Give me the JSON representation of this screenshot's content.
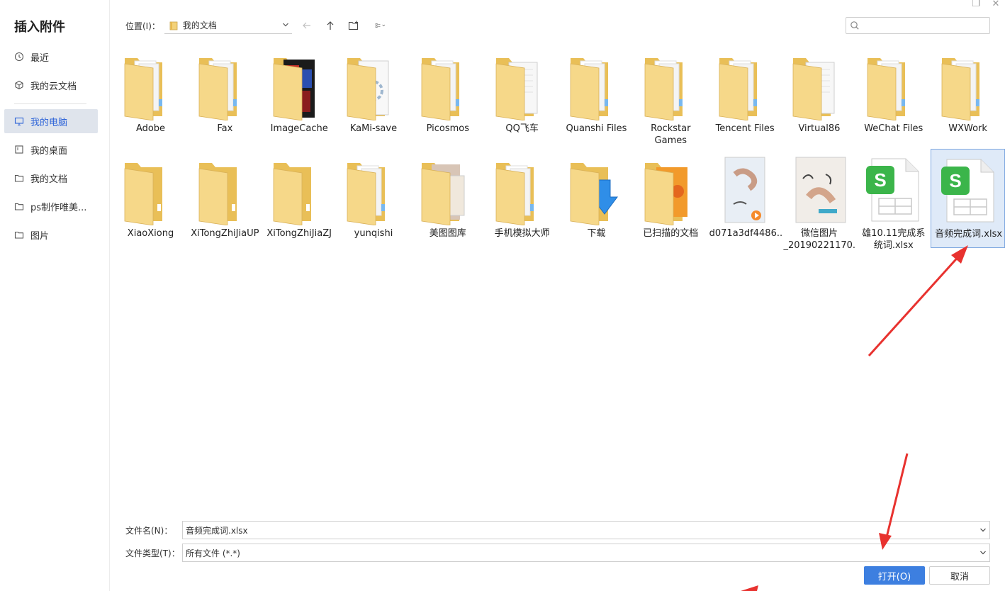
{
  "window": {
    "restore_glyph": "❐",
    "close_glyph": "✕"
  },
  "sidebar": {
    "title": "插入附件",
    "items": [
      {
        "label": "最近",
        "icon": "clock-icon",
        "active": false
      },
      {
        "label": "我的云文档",
        "icon": "cloud-doc-icon",
        "active": false
      },
      {
        "label": "我的电脑",
        "icon": "computer-icon",
        "active": true
      },
      {
        "label": "我的桌面",
        "icon": "desktop-icon",
        "active": false
      },
      {
        "label": "我的文档",
        "icon": "document-folder-icon",
        "active": false
      },
      {
        "label": "ps制作唯美...",
        "icon": "folder-icon",
        "active": false
      },
      {
        "label": "图片",
        "icon": "picture-folder-icon",
        "active": false
      }
    ]
  },
  "toolbar": {
    "location_label": "位置(I)：",
    "location_value": "我的文档",
    "back_icon": "arrow-left-icon",
    "up_icon": "arrow-up-icon",
    "new_folder_icon": "new-folder-icon",
    "view_icon": "list-view-icon"
  },
  "search": {
    "placeholder": "",
    "icon": "search-icon"
  },
  "files": {
    "row1": [
      {
        "name": "Adobe",
        "type": "folder"
      },
      {
        "name": "Fax",
        "type": "folder"
      },
      {
        "name": "ImageCache",
        "type": "folder-image"
      },
      {
        "name": "KaMi-save",
        "type": "folder-gear"
      },
      {
        "name": "Picosmos",
        "type": "folder"
      },
      {
        "name": "QQ飞车",
        "type": "folder-doc"
      },
      {
        "name": "Quanshi Files",
        "type": "folder"
      },
      {
        "name": "Rockstar Games",
        "type": "folder"
      },
      {
        "name": "Tencent Files",
        "type": "folder"
      },
      {
        "name": "Virtual86",
        "type": "folder-doc"
      },
      {
        "name": "WeChat Files",
        "type": "folder"
      },
      {
        "name": "WXWork",
        "type": "folder"
      }
    ],
    "row2": [
      {
        "name": "XiaoXiong",
        "type": "folder-empty"
      },
      {
        "name": "XiTongZhiJiaUP",
        "type": "folder-empty"
      },
      {
        "name": "XiTongZhiJiaZJ",
        "type": "folder-empty"
      },
      {
        "name": "yunqishi",
        "type": "folder"
      },
      {
        "name": "美图图库",
        "type": "folder-photo"
      },
      {
        "name": "手机模拟大师",
        "type": "folder"
      },
      {
        "name": "下载",
        "type": "folder-download"
      },
      {
        "name": "已扫描的文档",
        "type": "folder-flowers"
      },
      {
        "name": "d071a3df4486...",
        "type": "video"
      },
      {
        "name": "微信图片_20190221170...",
        "type": "image"
      },
      {
        "name": "雄10.11完成系统词.xlsx",
        "type": "xlsx"
      },
      {
        "name": "音频完成词.xlsx",
        "type": "xlsx",
        "selected": true
      }
    ]
  },
  "form": {
    "filename_label": "文件名(N)：",
    "filename_value": "音频完成词.xlsx",
    "filetype_label": "文件类型(T)：",
    "filetype_value": "所有文件 (*.*)"
  },
  "buttons": {
    "open": "打开(O)",
    "cancel": "取消"
  },
  "colors": {
    "accent": "#3d7fe0",
    "folder": "#f3d27a",
    "xlsx_green": "#3bb54a",
    "annotation": "#e8322f"
  }
}
